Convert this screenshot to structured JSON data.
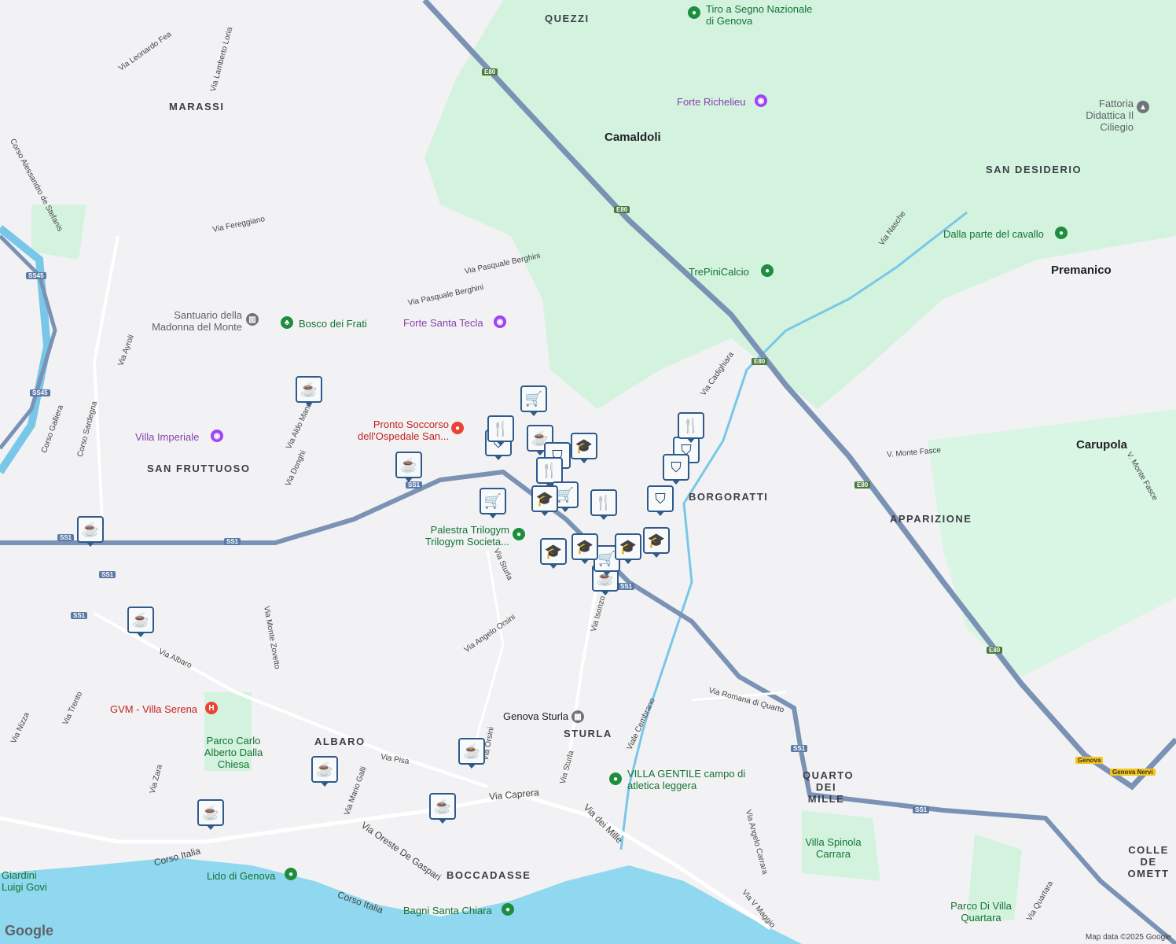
{
  "map": {
    "colors": {
      "land": "#f2f2f4",
      "green": "#d4f3df",
      "water": "#8fd8ef",
      "river": "#79c7e8",
      "highway": "#7a92b4",
      "road": "#ffffff",
      "marker_border": "#2f5a8a",
      "marker_fill": "#f8f9fa"
    },
    "areas": [
      "QUEZZI",
      "MARASSI",
      "SAN DESIDERIO",
      "SAN FRUTTUOSO",
      "BORGORATTI",
      "APPARIZIONE",
      "ALBARO",
      "STURLA",
      "QUARTO DEI MILLE",
      "BOCCADASSE",
      "COLLE DE OMETT"
    ],
    "towns": [
      "Camaldoli",
      "Premanico",
      "Carupola"
    ],
    "streets": [
      "Via Leonardo Fea",
      "Via Lamberto Loria",
      "Corso Alessandro de Stefanis",
      "Via Fereggiano",
      "Via Pasquale Berghini",
      "Via Pasquale Berghini",
      "Via Ayroli",
      "Corso Sardegna",
      "Corso Galliera",
      "Via Aldo Manuzio",
      "Via Donghi",
      "Via Cadighiara",
      "V. Monte Fasce",
      "V. Monte Fasce",
      "Via Nasche",
      "Via Sturla",
      "Via Angelo Orsini",
      "Via Isonzo",
      "Via Monte Zovetto",
      "Via Albaro",
      "Via Trento",
      "Via Nizza",
      "Via Zara",
      "Via Pisa",
      "Via Mario Galli",
      "Via Caprera",
      "Via Oreste De Gaspari",
      "Corso Italia",
      "Corso Italia",
      "Via dei Mille",
      "Viale Cembrano",
      "Via Romana di Quarto",
      "Via Angelo Carrara",
      "Via V Maggio",
      "Via Quartara",
      "Via Orsini",
      "Via Sturla"
    ],
    "pois": [
      {
        "name": "Tiro a Segno Nazionale di Genova",
        "kind": "green"
      },
      {
        "name": "Forte Richelieu",
        "kind": "purple"
      },
      {
        "name": "Fattoria Didattica Il Ciliegio",
        "kind": "gray"
      },
      {
        "name": "Dalla parte del cavallo",
        "kind": "green"
      },
      {
        "name": "TrePiniCalcio",
        "kind": "green"
      },
      {
        "name": "Santuario della Madonna del Monte",
        "kind": "gray"
      },
      {
        "name": "Bosco dei Frati",
        "kind": "green"
      },
      {
        "name": "Forte Santa Tecla",
        "kind": "purple"
      },
      {
        "name": "Pronto Soccorso dell'Ospedale San...",
        "kind": "red"
      },
      {
        "name": "Villa Imperiale",
        "kind": "purple"
      },
      {
        "name": "Palestra Trilogym Trilogym Societa...",
        "kind": "green"
      },
      {
        "name": "GVM - Villa Serena",
        "kind": "red"
      },
      {
        "name": "Parco Carlo Alberto Dalla Chiesa",
        "kind": "green"
      },
      {
        "name": "Genova Sturla",
        "kind": "gray"
      },
      {
        "name": "VILLA GENTILE campo di atletica leggera",
        "kind": "green"
      },
      {
        "name": "Villa Spinola Carrara",
        "kind": "green"
      },
      {
        "name": "Lido di Genova",
        "kind": "green"
      },
      {
        "name": "Bagni Santa Chiara",
        "kind": "green"
      },
      {
        "name": "Giardini Luigi Govi",
        "kind": "green"
      },
      {
        "name": "Parco Di Villa Quartara",
        "kind": "green"
      }
    ],
    "shields": [
      "E80",
      "E80",
      "E80",
      "E80",
      "E80",
      "SS45",
      "SS45",
      "SS1",
      "SS1",
      "SS1",
      "SS1",
      "SS1",
      "SS1",
      "SS1",
      "SS1",
      "Genova",
      "Genova Nervi"
    ],
    "markers": [
      "cafe",
      "cafe",
      "cafe",
      "cafe",
      "cafe",
      "cafe",
      "cafe",
      "cafe",
      "cafe",
      "cafe",
      "shop",
      "shop",
      "shop",
      "shop",
      "shop",
      "restaurant",
      "restaurant",
      "restaurant",
      "restaurant",
      "grocery",
      "grocery",
      "grocery",
      "grocery",
      "school",
      "school",
      "school",
      "school",
      "school",
      "school"
    ],
    "attribution": "Map data ©2025 Google",
    "logo": "Google"
  }
}
